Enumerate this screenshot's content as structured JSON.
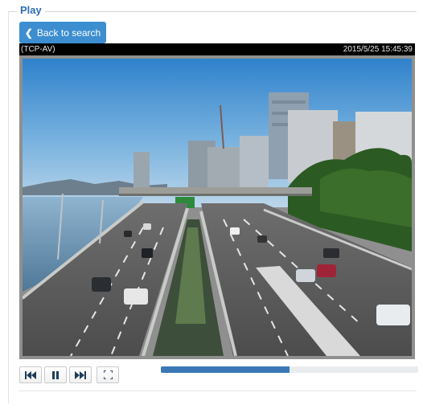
{
  "panel": {
    "legend": "Play"
  },
  "toolbar": {
    "back_label": "Back to search"
  },
  "video": {
    "camera_name": "(TCP-AV)",
    "timestamp": "2015/5/25 15:45:39"
  },
  "playback": {
    "progress_fraction": 0.5,
    "buttons": [
      {
        "name": "previous-button",
        "icon": "skip-back-icon"
      },
      {
        "name": "pause-button",
        "icon": "pause-icon"
      },
      {
        "name": "next-button",
        "icon": "skip-forward-icon"
      },
      {
        "name": "fullscreen-button",
        "icon": "fullscreen-icon"
      }
    ]
  },
  "colors": {
    "accent": "#3c8ed0",
    "legend_text": "#2e6fb0",
    "progress_fill": "#3b78b7",
    "progress_track": "#e9ecef"
  }
}
